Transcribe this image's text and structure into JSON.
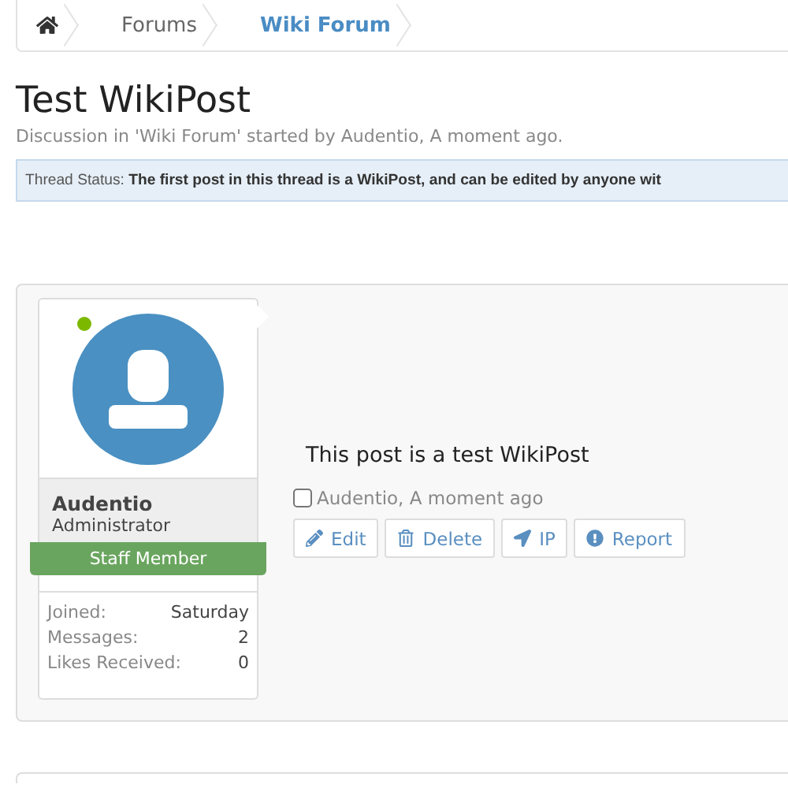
{
  "breadcrumb": {
    "items": [
      {
        "label": "Forums",
        "selected": false
      },
      {
        "label": "Wiki Forum",
        "selected": true
      }
    ]
  },
  "title": "Test WikiPost",
  "subtitle": "Discussion in 'Wiki Forum' started by Audentio, A moment ago.",
  "thread_status": {
    "label": "Thread Status:",
    "text": "The first post in this thread is a WikiPost, and can be edited by anyone wit"
  },
  "post": {
    "user": {
      "name": "Audentio",
      "role": "Administrator",
      "online": true,
      "banner": "Staff Member",
      "stats": [
        {
          "label": "Joined:",
          "value": "Saturday"
        },
        {
          "label": "Messages:",
          "value": "2"
        },
        {
          "label": "Likes Received:",
          "value": "0"
        }
      ]
    },
    "message": "This post is a test WikiPost",
    "checked": false,
    "meta": "Audentio, A moment ago",
    "actions": [
      {
        "label": "Edit",
        "kind": "edit"
      },
      {
        "label": "Delete",
        "kind": "delete"
      },
      {
        "label": "IP",
        "kind": "ip"
      },
      {
        "label": "Report",
        "kind": "report"
      }
    ]
  }
}
